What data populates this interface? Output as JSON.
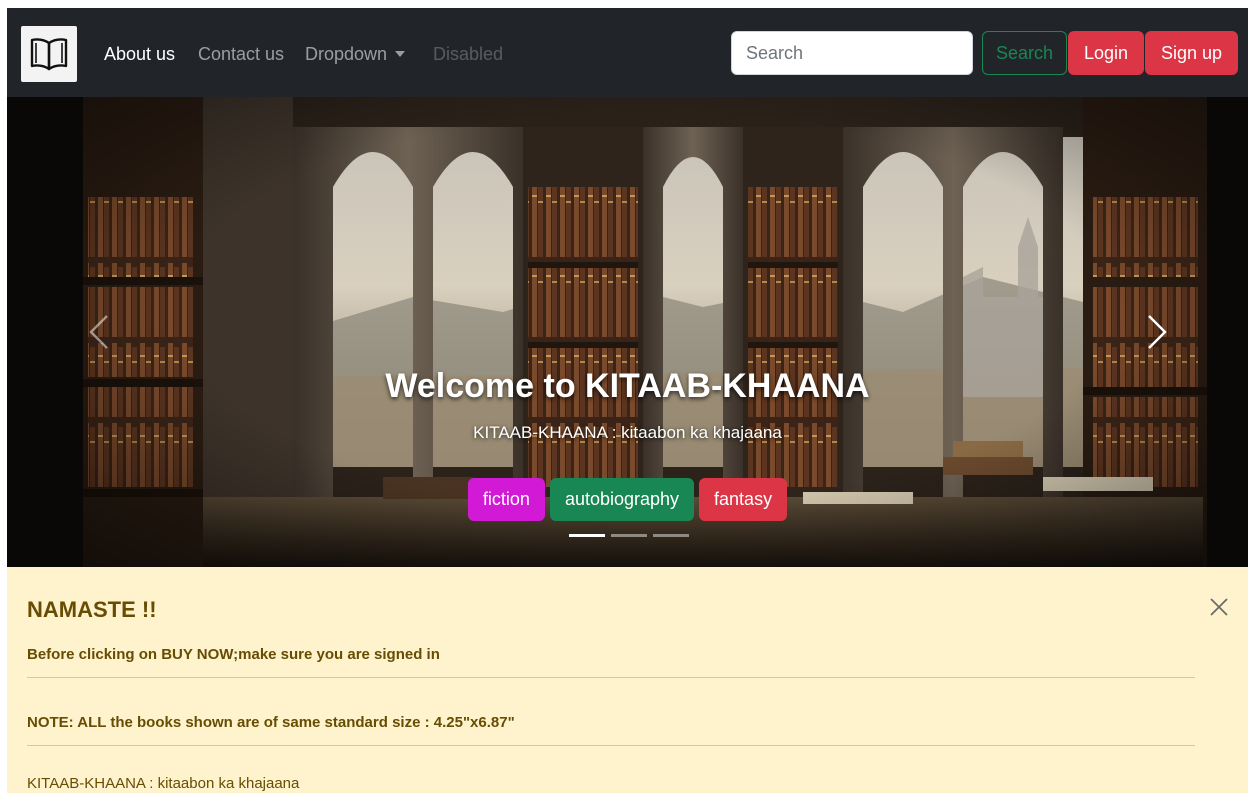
{
  "navbar": {
    "brand_icon": "open-book-icon",
    "links": [
      {
        "label": "About us",
        "state": "active"
      },
      {
        "label": "Contact us",
        "state": "normal"
      },
      {
        "label": "Dropdown",
        "state": "normal"
      },
      {
        "label": "Disabled",
        "state": "disabled"
      }
    ],
    "search_placeholder": "Search",
    "search_button": "Search",
    "login_button": "Login",
    "signup_button": "Sign up"
  },
  "carousel": {
    "heading": "Welcome to KITAAB-KHAANA",
    "subheading": "KITAAB-KHAANA : kitaabon ka khajaana",
    "tags": [
      "fiction",
      "autobiography",
      "fantasy"
    ],
    "slide_count": 3,
    "active_slide": 1,
    "prev_icon": "chevron-left-icon",
    "next_icon": "chevron-right-icon"
  },
  "alert": {
    "heading": "NAMASTE !!",
    "line1": "Before clicking on BUY NOW;make sure you are signed in",
    "note_label": "NOTE",
    "note_text": ": ALL the books shown are of same standard size : 4.25\"x6.87\"",
    "footer": "KITAAB-KHAANA : kitaabon ka khajaana",
    "close_icon": "close-icon"
  },
  "colors": {
    "navbar_bg": "#212529",
    "success": "#198754",
    "danger": "#dc3545",
    "fiction_tag": "#d119d6",
    "alert_bg": "#fff3cd",
    "alert_text": "#664d03"
  }
}
